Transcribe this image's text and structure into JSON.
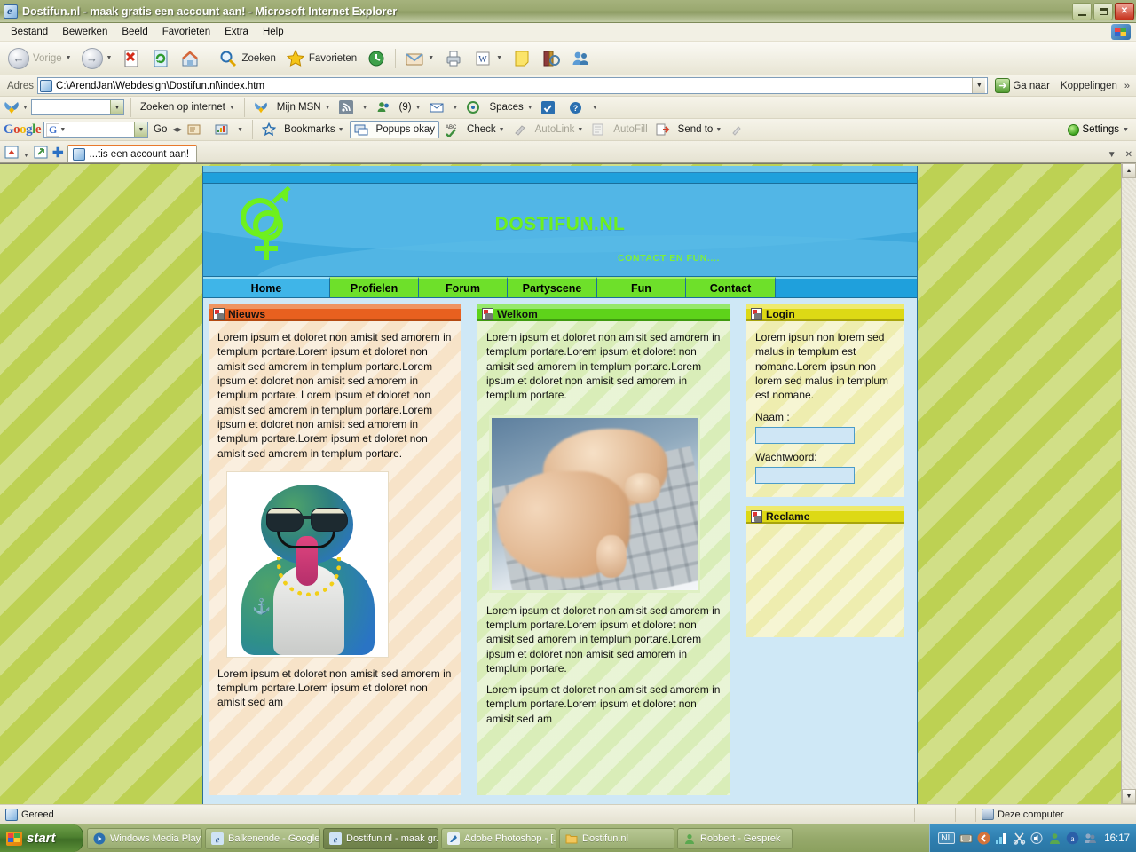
{
  "window": {
    "title": "Dostifun.nl - maak gratis een account aan! - Microsoft Internet Explorer",
    "icon": "ie-icon",
    "minimize": "minimize-button",
    "maximize": "restore-button",
    "close": "close-button"
  },
  "menu": {
    "items": [
      "Bestand",
      "Bewerken",
      "Beeld",
      "Favorieten",
      "Extra",
      "Help"
    ]
  },
  "toolbar": {
    "back": "Vorige",
    "forward": "",
    "stop": "",
    "refresh": "",
    "home": "",
    "search": "Zoeken",
    "favorites": "Favorieten",
    "history": "",
    "mail": "",
    "print": "",
    "edit": "W",
    "notes": "",
    "research": "",
    "messenger": ""
  },
  "address": {
    "label": "Adres",
    "value": "C:\\ArendJan\\Webdesign\\Dostifun.nl\\index.htm",
    "go": "Ga naar",
    "links": "Koppelingen"
  },
  "msnbar": {
    "search_value": "",
    "web_search": "Zoeken op internet",
    "my_msn": "Mijn MSN",
    "feeds": "",
    "contacts": "(9)",
    "mail": "",
    "spaces": "Spaces",
    "check": "",
    "help": ""
  },
  "googlebar": {
    "logo": "Google",
    "search_value": "",
    "go": "Go",
    "bookmarks": "Bookmarks",
    "popups": "Popups okay",
    "check": "Check",
    "autolink": "AutoLink",
    "autofill": "AutoFill",
    "sendto": "Send to",
    "settings": "Settings"
  },
  "tabstrip": {
    "tab_label": "...tis een account aan!"
  },
  "site": {
    "title": "DOSTIFUN.NL",
    "subtitle": "CONTACT EN FUN....",
    "nav": [
      {
        "label": "Home",
        "active": true
      },
      {
        "label": "Profielen",
        "active": false
      },
      {
        "label": "Forum",
        "active": false
      },
      {
        "label": "Partyscene",
        "active": false
      },
      {
        "label": "Fun",
        "active": false
      },
      {
        "label": "Contact",
        "active": false
      }
    ],
    "panels": {
      "nieuws": {
        "title": "Nieuws",
        "body": "Lorem ipsum et doloret non amisit sed amorem in templum portare.Lorem ipsum et doloret non amisit sed amorem in templum portare.Lorem ipsum et doloret non amisit sed amorem in templum portare. Lorem ipsum et doloret non amisit sed amorem in templum portare.Lorem ipsum et doloret non amisit sed amorem in templum portare.Lorem ipsum et doloret non amisit sed amorem in templum portare.",
        "image_alt": "msn-avatar-image",
        "footer": "Lorem ipsum et doloret non amisit sed amorem in templum portare.Lorem ipsum et doloret non amisit sed am"
      },
      "welkom": {
        "title": "Welkom",
        "body": "Lorem ipsum et doloret non amisit sed amorem in templum portare.Lorem ipsum et doloret non amisit sed amorem in templum portare.Lorem ipsum et doloret non amisit sed amorem in templum portare.",
        "image_alt": "hands-typing-keyboard-photo",
        "body2": "Lorem ipsum et doloret non amisit sed amorem in templum portare.Lorem ipsum et doloret non amisit sed amorem in templum portare.Lorem ipsum et doloret non amisit sed amorem in templum portare.",
        "footer": "Lorem ipsum et doloret non amisit sed amorem in templum portare.Lorem ipsum et doloret non amisit sed am"
      },
      "login": {
        "title": "Login",
        "body": "Lorem ipsun non lorem sed malus in templum est nomane.Lorem ipsun non lorem sed malus in templum est nomane.",
        "name_label": "Naam :",
        "name_value": "",
        "password_label": "Wachtwoord:",
        "password_value": ""
      },
      "reclame": {
        "title": "Reclame",
        "body": ""
      }
    },
    "colors": {
      "banner": "#3fa9dd",
      "title_green": "#6ef01e",
      "nav_green": "#6ee02a",
      "nieuws_header": "#e8601f",
      "welkom_header": "#5ed31a",
      "login_header": "#ddd915",
      "page_bg": "#bdd153"
    }
  },
  "statusbar": {
    "message": "Gereed",
    "zone": "Deze computer"
  },
  "taskbar": {
    "start": "start",
    "tasks": [
      {
        "label": "Windows Media Player",
        "active": false
      },
      {
        "label": "Balkenende - Google ...",
        "active": false
      },
      {
        "label": "Dostifun.nl - maak gr...",
        "active": true
      },
      {
        "label": "Adobe Photoshop - [...",
        "active": false
      },
      {
        "label": "Dostifun.nl",
        "active": false
      },
      {
        "label": "Robbert - Gesprek",
        "active": false
      }
    ],
    "language": "NL",
    "clock": "16:17"
  }
}
